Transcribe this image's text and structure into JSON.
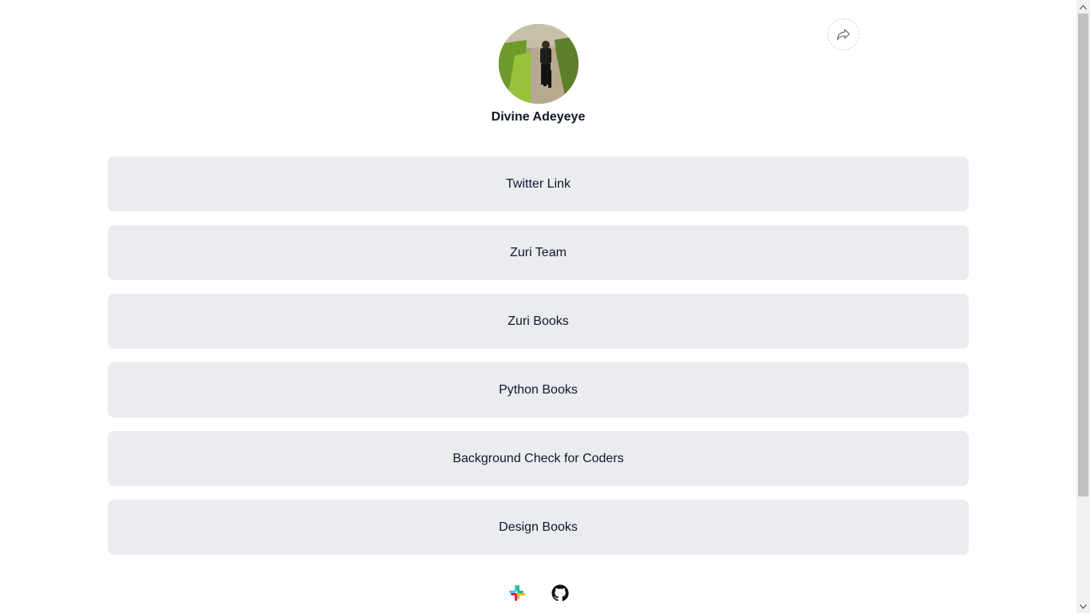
{
  "profile": {
    "name": "Divine Adeyeye",
    "avatar_icon": "profile-photo"
  },
  "share": {
    "icon": "share-arrow-icon"
  },
  "links": [
    {
      "label": "Twitter Link"
    },
    {
      "label": "Zuri Team"
    },
    {
      "label": "Zuri Books"
    },
    {
      "label": "Python Books"
    },
    {
      "label": "Background Check for Coders"
    },
    {
      "label": "Design Books"
    }
  ],
  "footer": {
    "icons": [
      "slack-icon",
      "github-icon"
    ]
  },
  "colors": {
    "button_bg": "#eaecf0",
    "text": "#101828",
    "share_border": "#d0d5dd"
  }
}
